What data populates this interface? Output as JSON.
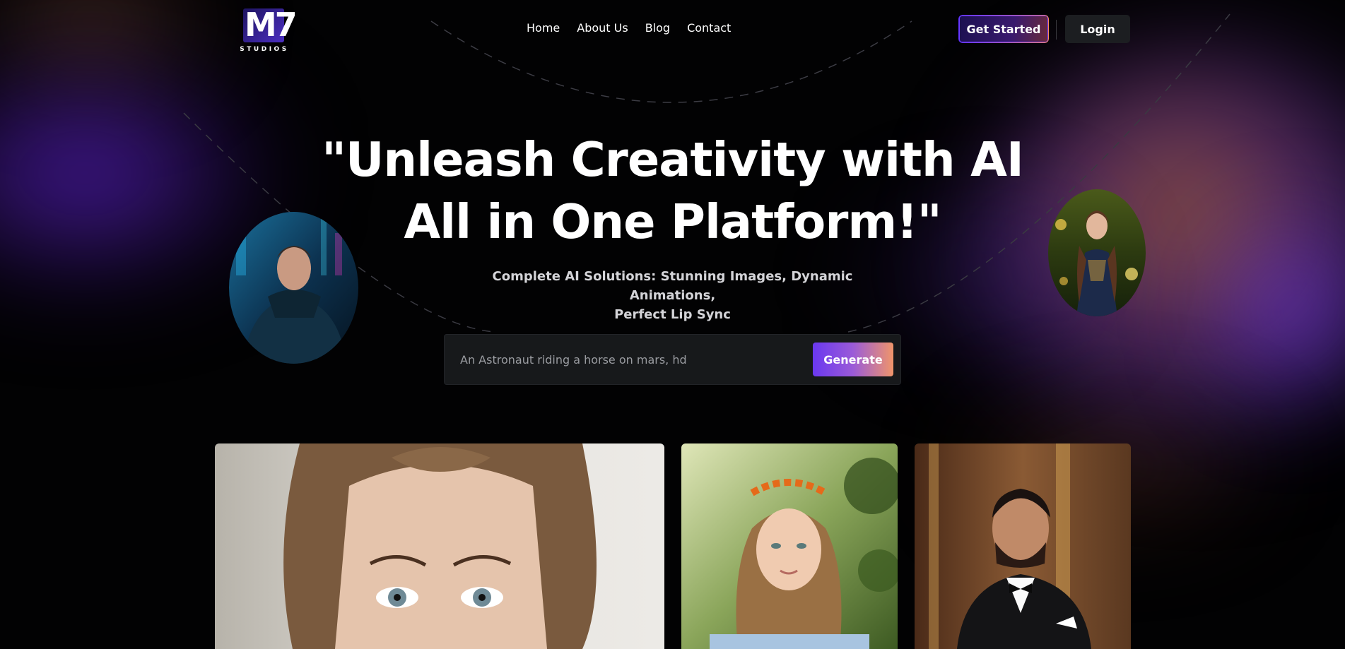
{
  "brand": {
    "logo_mark": "M7",
    "logo_sub": "STUDIOS"
  },
  "nav": {
    "items": [
      {
        "label": "Home"
      },
      {
        "label": "About Us"
      },
      {
        "label": "Blog"
      },
      {
        "label": "Contact"
      }
    ]
  },
  "header": {
    "get_started_label": "Get Started",
    "login_label": "Login"
  },
  "hero": {
    "title_line1": "\"Unleash Creativity with AI",
    "title_line2": "All in One Platform!\"",
    "subtitle_line1": "Complete AI Solutions: Stunning Images, Dynamic Animations,",
    "subtitle_line2": "Perfect Lip Sync"
  },
  "prompt": {
    "placeholder": "An Astronaut riding a horse on mars, hd",
    "generate_label": "Generate"
  },
  "colors": {
    "accent_purple": "#6a38f0",
    "accent_orange": "#f0956a",
    "background": "#020203"
  }
}
